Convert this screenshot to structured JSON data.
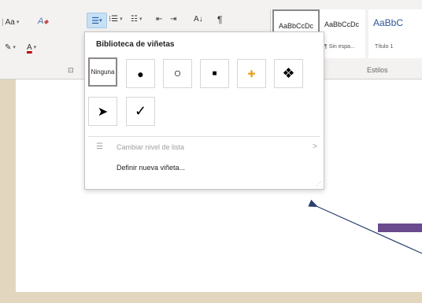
{
  "ribbon": {
    "font_size_label": "Aa",
    "clear_format_icon": "clear-formatting-icon",
    "highlight_label": "",
    "font_color_label": "A",
    "paragraph_mark": "¶",
    "sort_label": "A↓",
    "bullets_icon": "bullets-icon",
    "numbering_icon": "numbering-icon",
    "multilevel_icon": "multilevel-list-icon",
    "decrease_indent_icon": "decrease-indent-icon",
    "increase_indent_icon": "increase-indent-icon",
    "launcher_glyph": "⊡"
  },
  "styles": {
    "group_label": "Estilos",
    "tiles": [
      {
        "preview": "AaBbCcDc",
        "name": ""
      },
      {
        "preview": "AaBbCcDc",
        "name": "¶ Sin espa..."
      },
      {
        "preview": "AaBbC",
        "name": "Título 1"
      }
    ]
  },
  "bullet_menu": {
    "title": "Biblioteca de viñetas",
    "none_label": "Ninguna",
    "bullets": [
      {
        "glyph": "●",
        "name": "filled-circle-bullet"
      },
      {
        "glyph": "○",
        "name": "hollow-circle-bullet"
      },
      {
        "glyph": "■",
        "name": "filled-square-bullet"
      },
      {
        "glyph": "✚",
        "name": "colored-cross-bullet"
      },
      {
        "glyph": "❖",
        "name": "diamond-cluster-bullet"
      },
      {
        "glyph": "➤",
        "name": "arrowhead-bullet"
      },
      {
        "glyph": "✓",
        "name": "checkmark-bullet"
      }
    ],
    "change_level_label": "Cambiar nivel de lista",
    "define_new_label": "Definir nueva viñeta...",
    "submenu_arrow": ">"
  },
  "colors": {
    "purple_annotation": "#6b4a8e",
    "menu_selection": "#c7e0f4"
  }
}
